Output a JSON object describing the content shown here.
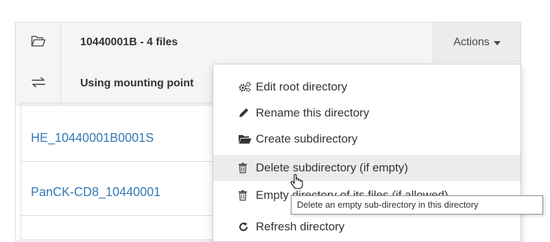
{
  "header": {
    "title": "10440001B - 4 files",
    "actions_label": "Actions"
  },
  "mount": {
    "text": "Using mounting point"
  },
  "files": [
    {
      "name": "HE_10440001B0001S"
    },
    {
      "name": "PanCK-CD8_10440001"
    }
  ],
  "menu": {
    "items": [
      {
        "label": "Edit root directory",
        "icon": "cogs-icon"
      },
      {
        "label": "Rename this directory",
        "icon": "pencil-icon"
      },
      {
        "label": "Create subdirectory",
        "icon": "folder-open-icon"
      },
      {
        "label": "Delete subdirectory (if empty)",
        "icon": "trash-icon"
      },
      {
        "label": "Empty directory of its files (if allowed)",
        "icon": "trash-icon"
      },
      {
        "label": "Refresh directory",
        "icon": "refresh-icon"
      }
    ],
    "highlighted_index": 3
  },
  "tooltip": {
    "text": "Delete an empty sub-directory in this directory"
  },
  "colors": {
    "link": "#337ab7",
    "header_bg": "#f5f5f5",
    "highlight_bg": "#ececec",
    "border": "#dcdcdc"
  }
}
